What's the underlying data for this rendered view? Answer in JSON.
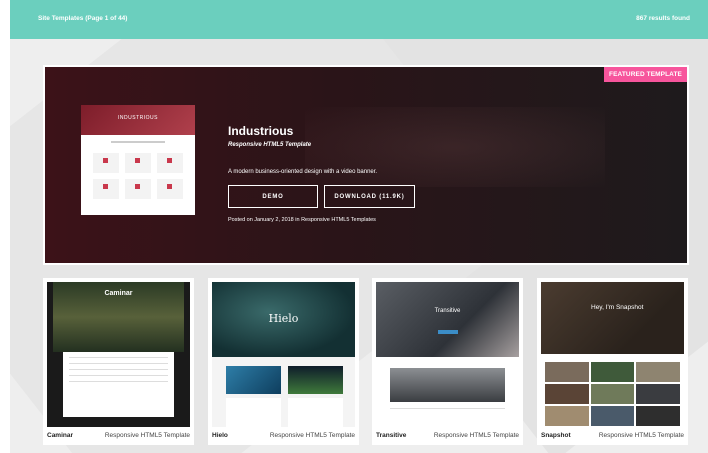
{
  "header": {
    "title": "Site Templates (Page 1 of 44)",
    "results": "867 results found"
  },
  "featured": {
    "badge": "FEATURED TEMPLATE",
    "thumb_label": "INDUSTRIOUS",
    "title": "Industrious",
    "subtitle": "Responsive HTML5 Template",
    "description": "A modern business-oriented design with a video banner.",
    "demo_label": "DEMO",
    "download_label": "DOWNLOAD (11.9K)",
    "posted": "Posted on January 2, 2018 in Responsive HTML5 Templates"
  },
  "cards": [
    {
      "name": "Caminar",
      "type": "Responsive HTML5 Template",
      "hero": "Caminar"
    },
    {
      "name": "Hielo",
      "type": "Responsive HTML5 Template",
      "hero": "Hielo"
    },
    {
      "name": "Transitive",
      "type": "Responsive HTML5 Template",
      "hero": "Transitive"
    },
    {
      "name": "Snapshot",
      "type": "Responsive HTML5 Template",
      "hero": "Hey, I'm Snapshot"
    }
  ],
  "colors": {
    "header": "#6bcfbe",
    "badge": "#f7559c"
  }
}
